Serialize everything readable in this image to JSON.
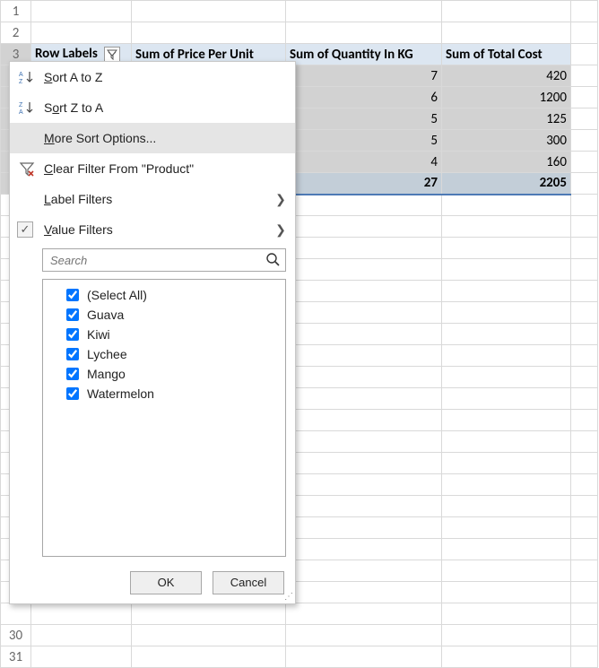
{
  "row_numbers_top": [
    "1",
    "2",
    "3"
  ],
  "row_numbers_bottom": [
    "30",
    "31"
  ],
  "pivot": {
    "headers": {
      "row_labels": "Row Labels",
      "price": "Sum of Price Per Unit",
      "qty": "Sum of Quantity In KG",
      "total": "Sum of Total Cost"
    },
    "rows": [
      {
        "qty": "7",
        "total": "420"
      },
      {
        "qty": "6",
        "total": "1200"
      },
      {
        "qty": "5",
        "total": "125"
      },
      {
        "qty": "5",
        "total": "300"
      },
      {
        "qty": "4",
        "total": "160"
      }
    ],
    "grand": {
      "qty": "27",
      "total": "2205"
    }
  },
  "menu": {
    "sort_az": "Sort A to Z",
    "sort_za": "Sort Z to A",
    "more_sort": "More Sort Options...",
    "clear_filter": "Clear Filter From \"Product\"",
    "label_filters": "Label Filters",
    "value_filters": "Value Filters",
    "search_placeholder": "Search",
    "items": [
      "(Select All)",
      "Guava",
      "Kiwi",
      "Lychee",
      "Mango",
      "Watermelon"
    ],
    "ok": "OK",
    "cancel": "Cancel"
  },
  "underline_chars": {
    "sort_az": "S",
    "sort_za": "o",
    "more_sort": "M",
    "clear_filter": "C",
    "label_filters": "L",
    "value_filters": "V"
  },
  "chart_data": {
    "type": "table",
    "columns": [
      "Row Labels",
      "Sum of Price Per Unit",
      "Sum of Quantity In KG",
      "Sum of Total Cost"
    ],
    "row_labels_hidden_behind_menu": [
      "Guava",
      "Kiwi",
      "Lychee",
      "Mango",
      "Watermelon"
    ],
    "values_visible": {
      "Sum of Quantity In KG": [
        7,
        6,
        5,
        5,
        4
      ],
      "Sum of Total Cost": [
        420,
        1200,
        125,
        300,
        160
      ]
    },
    "grand_total": {
      "Sum of Quantity In KG": 27,
      "Sum of Total Cost": 2205
    }
  }
}
